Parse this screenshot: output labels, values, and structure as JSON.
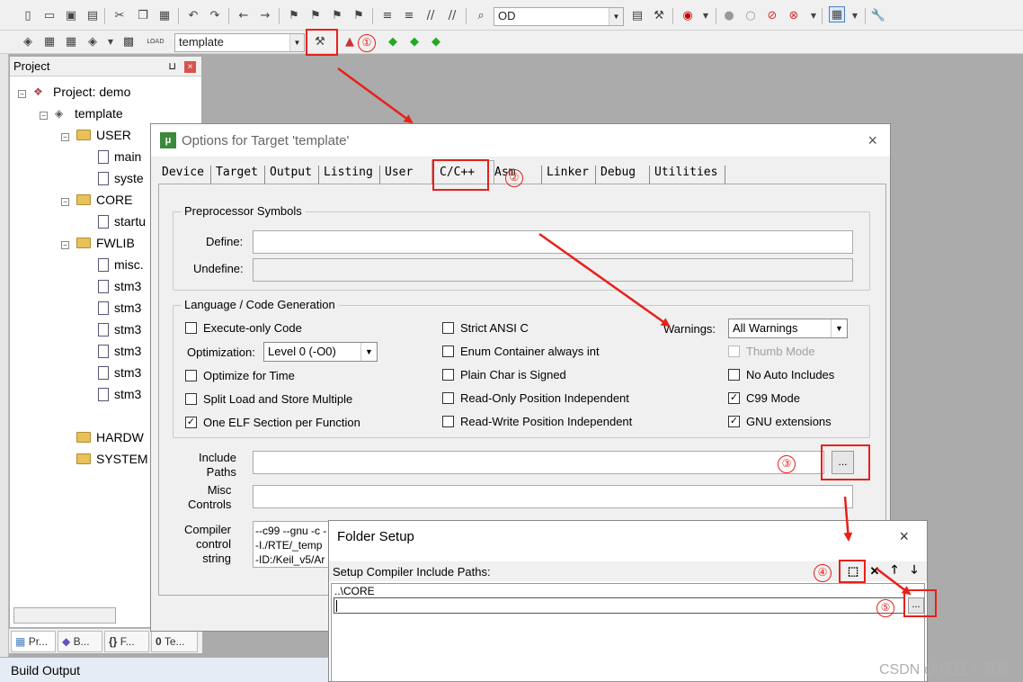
{
  "toolbar1": {
    "device_combo": "OD"
  },
  "toolbar2": {
    "target_combo": "template"
  },
  "project_panel": {
    "title": "Project",
    "pin": "⊔",
    "close": "×",
    "tree": [
      {
        "label": "Project: demo"
      },
      {
        "label": "template"
      },
      {
        "label": "USER"
      },
      {
        "label": "main"
      },
      {
        "label": "syste"
      },
      {
        "label": "CORE"
      },
      {
        "label": "startu"
      },
      {
        "label": "FWLIB"
      },
      {
        "label": "misc."
      },
      {
        "label": "stm3"
      },
      {
        "label": "stm3"
      },
      {
        "label": "stm3"
      },
      {
        "label": "stm3"
      },
      {
        "label": "stm3"
      },
      {
        "label": "stm3"
      },
      {
        "label": "HARDW"
      },
      {
        "label": "SYSTEM"
      }
    ],
    "bottom_tabs": [
      "Pr...",
      "B...",
      "F...",
      "Te..."
    ]
  },
  "build_output": "Build Output",
  "options_dialog": {
    "title": "Options for Target 'template'",
    "close": "×",
    "tabs": [
      "Device",
      "Target",
      "Output",
      "Listing",
      "User",
      "C/C++",
      "Asm",
      "Linker",
      "Debug",
      "Utilities"
    ],
    "active_tab": "C/C++",
    "preprocessor": {
      "group_title": "Preprocessor Symbols",
      "define_label": "Define:",
      "define_value": "",
      "undefine_label": "Undefine:",
      "undefine_value": ""
    },
    "language": {
      "group_title": "Language / Code Generation",
      "execute_only": "Execute-only Code",
      "optimization_label": "Optimization:",
      "optimization_value": "Level 0 (-O0)",
      "optimize_time": "Optimize for Time",
      "split_load": "Split Load and Store Multiple",
      "one_elf": "One ELF Section per Function",
      "strict_ansi": "Strict ANSI C",
      "enum_container": "Enum Container always int",
      "plain_char": "Plain Char is Signed",
      "ro_pi": "Read-Only Position Independent",
      "rw_pi": "Read-Write Position Independent",
      "warnings_label": "Warnings:",
      "warnings_value": "All Warnings",
      "thumb_mode": "Thumb Mode",
      "no_auto_includes": "No Auto Includes",
      "c99_mode": "C99 Mode",
      "gnu_extensions": "GNU extensions"
    },
    "include_paths_label": [
      "Include",
      "Paths"
    ],
    "misc_controls_label": [
      "Misc",
      "Controls"
    ],
    "compiler_control_label": [
      "Compiler",
      "control",
      "string"
    ],
    "compiler_control_lines": [
      "--c99 --gnu -c -",
      "-I./RTE/_temp",
      "-ID:/Keil_v5/Ar"
    ],
    "dots": "..."
  },
  "folder_setup": {
    "title": "Folder Setup",
    "close": "×",
    "label": "Setup Compiler Include Paths:",
    "paths": [
      "..\\CORE"
    ],
    "dots": "..."
  },
  "annotations": [
    "①",
    "②",
    "③",
    "④",
    "⑤"
  ],
  "watermark": "CSDN @夜空丫流星",
  "colors": {
    "annotation": "#e8201a"
  }
}
